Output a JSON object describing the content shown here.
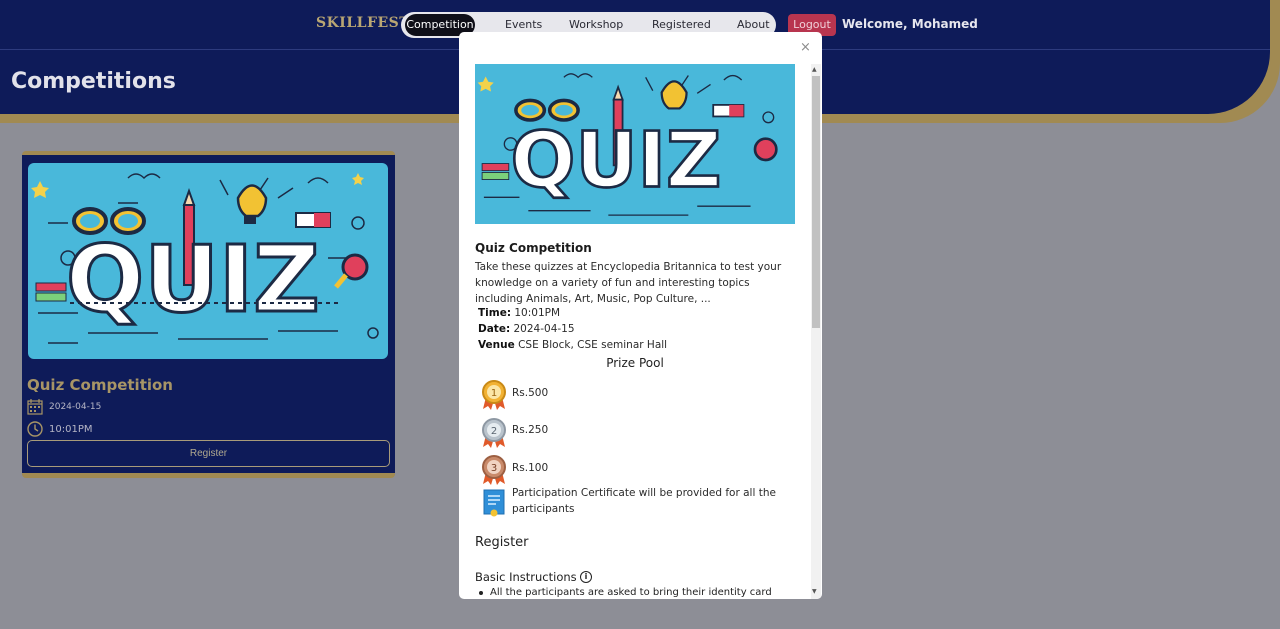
{
  "nav": {
    "brand": "SKILLFEST",
    "items": [
      {
        "label": "Competition",
        "active": true
      },
      {
        "label": "Events"
      },
      {
        "label": "Workshop"
      },
      {
        "label": "Registered"
      },
      {
        "label": "About"
      }
    ],
    "logout": "Logout",
    "welcome": "Welcome, Mohamed"
  },
  "page": {
    "title": "Competitions"
  },
  "card": {
    "title": "Quiz Competition",
    "date": "2024-04-15",
    "time": "10:01PM",
    "register": "Register",
    "image_text": "QUIZ"
  },
  "modal": {
    "close": "×",
    "image_text": "QUIZ",
    "title": "Quiz Competition",
    "description": "Take these quizzes at Encyclopedia Britannica to test your knowledge on a variety of fun and interesting topics including Animals, Art, Music, Pop Culture, ...",
    "time_label": "Time:",
    "time_value": "10:01PM",
    "date_label": "Date:",
    "date_value": "2024-04-15",
    "venue_label": "Venue",
    "venue_value": "CSE Block, CSE seminar Hall",
    "prize_title": "Prize Pool",
    "prizes": [
      {
        "rank": "1",
        "amount": "Rs.500"
      },
      {
        "rank": "2",
        "amount": "Rs.250"
      },
      {
        "rank": "3",
        "amount": "Rs.100"
      }
    ],
    "certificate": "Participation Certificate will be provided for all the participants",
    "register_title": "Register",
    "instructions_title": "Basic Instructions",
    "instructions": [
      "All the participants are asked to bring their identity card"
    ]
  },
  "colors": {
    "header": "#0e1b59",
    "gold": "#a18a52",
    "logout": "#b8354f",
    "quiz_bg": "#49b8da"
  },
  "icons": [
    "calendar-icon",
    "clock-icon",
    "close-icon",
    "info-icon",
    "medal-gold-icon",
    "medal-silver-icon",
    "medal-bronze-icon",
    "certificate-icon"
  ]
}
